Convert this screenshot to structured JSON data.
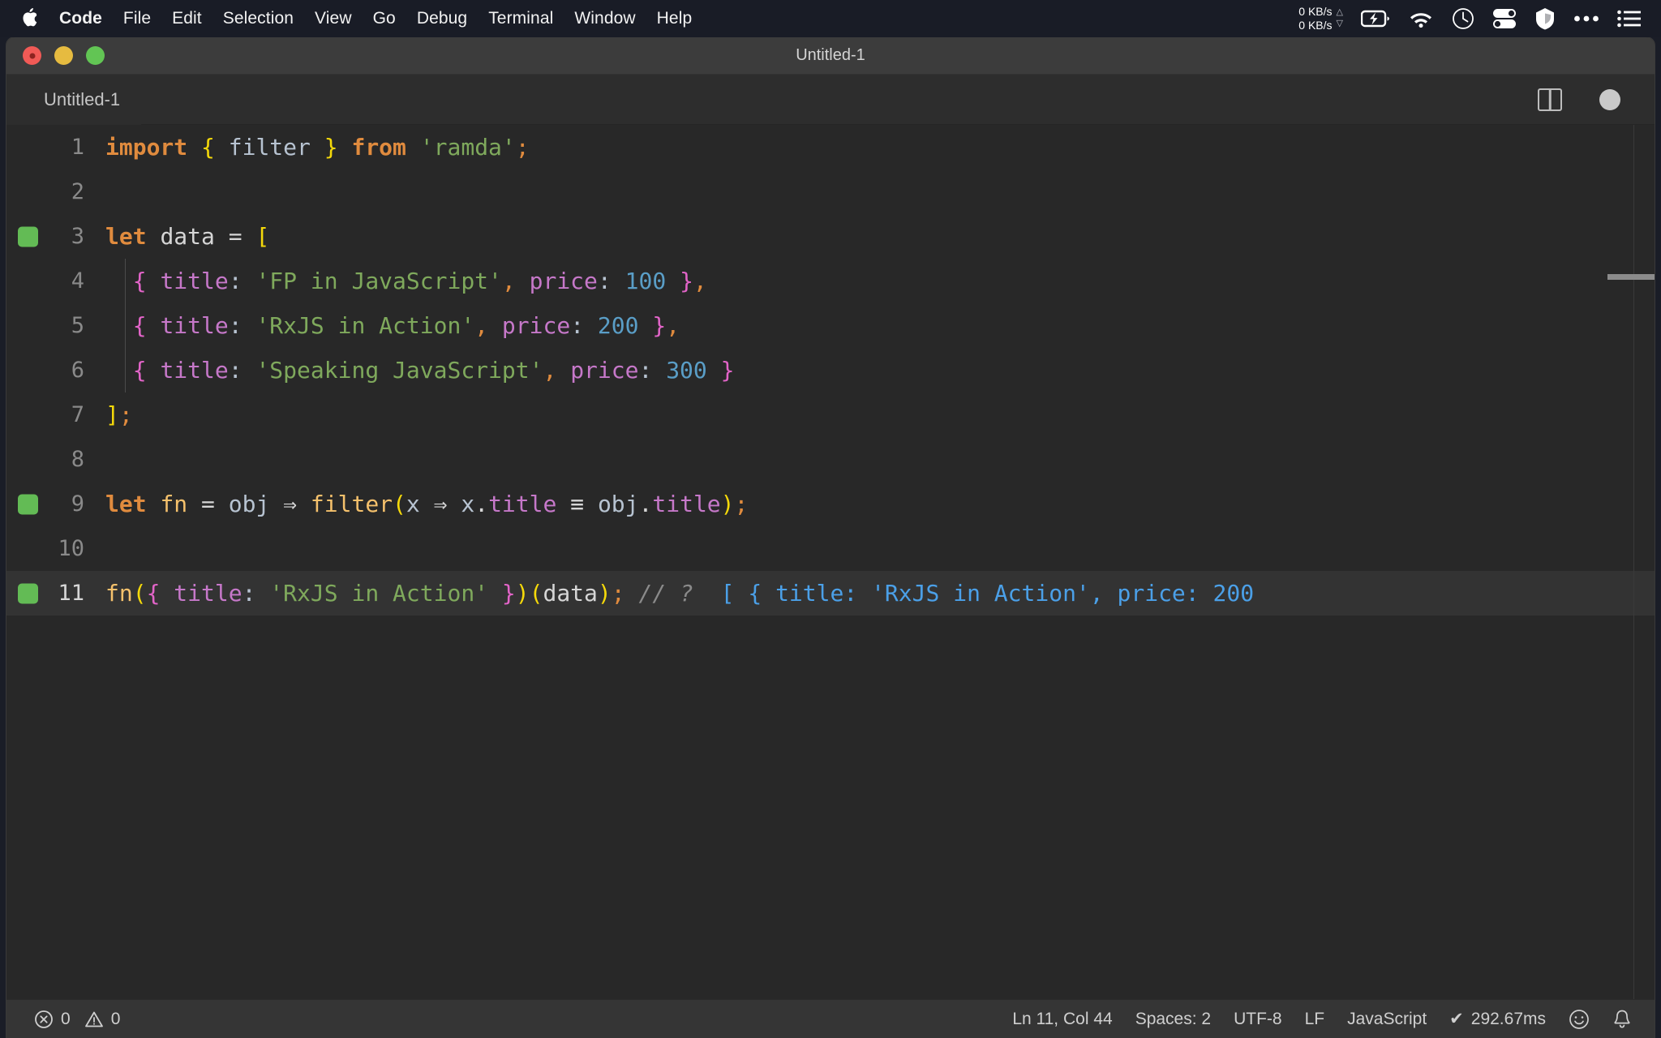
{
  "menubar": {
    "apple_icon": "apple-logo-icon",
    "items": [
      {
        "label": "Code",
        "bold": true
      },
      {
        "label": "File",
        "bold": false
      },
      {
        "label": "Edit",
        "bold": false
      },
      {
        "label": "Selection",
        "bold": false
      },
      {
        "label": "View",
        "bold": false
      },
      {
        "label": "Go",
        "bold": false
      },
      {
        "label": "Debug",
        "bold": false
      },
      {
        "label": "Terminal",
        "bold": false
      },
      {
        "label": "Window",
        "bold": false
      },
      {
        "label": "Help",
        "bold": false
      }
    ],
    "status": {
      "net_up": "0 KB/s",
      "net_down": "0 KB/s",
      "up_arrow": "△",
      "down_arrow": "▽",
      "icons": [
        "battery-charging-icon",
        "wifi-icon",
        "clock-icon",
        "toggles-icon",
        "shield-icon",
        "ellipsis-icon",
        "list-menu-icon"
      ]
    }
  },
  "window": {
    "title": "Untitled-1",
    "traffic_lights": [
      "close-button",
      "minimize-button",
      "maximize-button"
    ]
  },
  "tabbar": {
    "tab_label": "Untitled-1",
    "split_editor_icon": "split-editor-icon",
    "unsaved_indicator": "unsaved-dot-icon"
  },
  "code": {
    "lines": [
      {
        "number": "1",
        "marker": false,
        "active": false,
        "indent_guide": false,
        "tokens": [
          {
            "text": "import",
            "cls": "t-kw-b"
          },
          {
            "text": " ",
            "cls": "t-plain"
          },
          {
            "text": "{",
            "cls": "t-brace-y"
          },
          {
            "text": " ",
            "cls": "t-plain"
          },
          {
            "text": "filter",
            "cls": "t-var"
          },
          {
            "text": " ",
            "cls": "t-plain"
          },
          {
            "text": "}",
            "cls": "t-brace-y"
          },
          {
            "text": " ",
            "cls": "t-plain"
          },
          {
            "text": "from",
            "cls": "t-kw-b"
          },
          {
            "text": " ",
            "cls": "t-plain"
          },
          {
            "text": "'ramda'",
            "cls": "t-str"
          },
          {
            "text": ";",
            "cls": "t-punct-o"
          }
        ]
      },
      {
        "number": "2",
        "marker": false,
        "active": false,
        "indent_guide": false,
        "tokens": []
      },
      {
        "number": "3",
        "marker": true,
        "active": false,
        "indent_guide": false,
        "tokens": [
          {
            "text": "let",
            "cls": "t-kw-b"
          },
          {
            "text": " ",
            "cls": "t-plain"
          },
          {
            "text": "data",
            "cls": "t-plain"
          },
          {
            "text": " = ",
            "cls": "t-plain"
          },
          {
            "text": "[",
            "cls": "t-brace-y"
          }
        ]
      },
      {
        "number": "4",
        "marker": false,
        "active": false,
        "indent_guide": true,
        "tokens": [
          {
            "text": "  ",
            "cls": "t-plain"
          },
          {
            "text": "{",
            "cls": "t-brace-p"
          },
          {
            "text": " ",
            "cls": "t-plain"
          },
          {
            "text": "title",
            "cls": "t-prop"
          },
          {
            "text": ":",
            "cls": "t-colon"
          },
          {
            "text": " ",
            "cls": "t-plain"
          },
          {
            "text": "'FP in JavaScript'",
            "cls": "t-str"
          },
          {
            "text": ",",
            "cls": "t-punct-o"
          },
          {
            "text": " ",
            "cls": "t-plain"
          },
          {
            "text": "price",
            "cls": "t-prop"
          },
          {
            "text": ":",
            "cls": "t-colon"
          },
          {
            "text": " ",
            "cls": "t-plain"
          },
          {
            "text": "100",
            "cls": "t-num"
          },
          {
            "text": " ",
            "cls": "t-plain"
          },
          {
            "text": "}",
            "cls": "t-brace-p"
          },
          {
            "text": ",",
            "cls": "t-punct-o"
          }
        ]
      },
      {
        "number": "5",
        "marker": false,
        "active": false,
        "indent_guide": true,
        "tokens": [
          {
            "text": "  ",
            "cls": "t-plain"
          },
          {
            "text": "{",
            "cls": "t-brace-p"
          },
          {
            "text": " ",
            "cls": "t-plain"
          },
          {
            "text": "title",
            "cls": "t-prop"
          },
          {
            "text": ":",
            "cls": "t-colon"
          },
          {
            "text": " ",
            "cls": "t-plain"
          },
          {
            "text": "'RxJS in Action'",
            "cls": "t-str"
          },
          {
            "text": ",",
            "cls": "t-punct-o"
          },
          {
            "text": " ",
            "cls": "t-plain"
          },
          {
            "text": "price",
            "cls": "t-prop"
          },
          {
            "text": ":",
            "cls": "t-colon"
          },
          {
            "text": " ",
            "cls": "t-plain"
          },
          {
            "text": "200",
            "cls": "t-num"
          },
          {
            "text": " ",
            "cls": "t-plain"
          },
          {
            "text": "}",
            "cls": "t-brace-p"
          },
          {
            "text": ",",
            "cls": "t-punct-o"
          }
        ]
      },
      {
        "number": "6",
        "marker": false,
        "active": false,
        "indent_guide": true,
        "tokens": [
          {
            "text": "  ",
            "cls": "t-plain"
          },
          {
            "text": "{",
            "cls": "t-brace-p"
          },
          {
            "text": " ",
            "cls": "t-plain"
          },
          {
            "text": "title",
            "cls": "t-prop"
          },
          {
            "text": ":",
            "cls": "t-colon"
          },
          {
            "text": " ",
            "cls": "t-plain"
          },
          {
            "text": "'Speaking JavaScript'",
            "cls": "t-str"
          },
          {
            "text": ",",
            "cls": "t-punct-o"
          },
          {
            "text": " ",
            "cls": "t-plain"
          },
          {
            "text": "price",
            "cls": "t-prop"
          },
          {
            "text": ":",
            "cls": "t-colon"
          },
          {
            "text": " ",
            "cls": "t-plain"
          },
          {
            "text": "300",
            "cls": "t-num"
          },
          {
            "text": " ",
            "cls": "t-plain"
          },
          {
            "text": "}",
            "cls": "t-brace-p"
          }
        ]
      },
      {
        "number": "7",
        "marker": false,
        "active": false,
        "indent_guide": false,
        "tokens": [
          {
            "text": "]",
            "cls": "t-brace-y"
          },
          {
            "text": ";",
            "cls": "t-punct-o"
          }
        ]
      },
      {
        "number": "8",
        "marker": false,
        "active": false,
        "indent_guide": false,
        "tokens": []
      },
      {
        "number": "9",
        "marker": true,
        "active": false,
        "indent_guide": false,
        "tokens": [
          {
            "text": "let",
            "cls": "t-kw-b"
          },
          {
            "text": " ",
            "cls": "t-plain"
          },
          {
            "text": "fn",
            "cls": "t-fn"
          },
          {
            "text": " = ",
            "cls": "t-plain"
          },
          {
            "text": "obj",
            "cls": "t-var"
          },
          {
            "text": " ⇒ ",
            "cls": "t-plain"
          },
          {
            "text": "filter",
            "cls": "t-fn"
          },
          {
            "text": "(",
            "cls": "t-brace-y"
          },
          {
            "text": "x",
            "cls": "t-var"
          },
          {
            "text": " ⇒ ",
            "cls": "t-plain"
          },
          {
            "text": "x",
            "cls": "t-var"
          },
          {
            "text": ".",
            "cls": "t-plain"
          },
          {
            "text": "title",
            "cls": "t-prop"
          },
          {
            "text": " ≡ ",
            "cls": "t-plain"
          },
          {
            "text": "obj",
            "cls": "t-var"
          },
          {
            "text": ".",
            "cls": "t-plain"
          },
          {
            "text": "title",
            "cls": "t-prop"
          },
          {
            "text": ")",
            "cls": "t-brace-y"
          },
          {
            "text": ";",
            "cls": "t-punct-o"
          }
        ]
      },
      {
        "number": "10",
        "marker": false,
        "active": false,
        "indent_guide": false,
        "tokens": []
      },
      {
        "number": "11",
        "marker": true,
        "active": true,
        "indent_guide": false,
        "tokens": [
          {
            "text": "fn",
            "cls": "t-fn"
          },
          {
            "text": "(",
            "cls": "t-brace-y"
          },
          {
            "text": "{",
            "cls": "t-brace-p"
          },
          {
            "text": " ",
            "cls": "t-plain"
          },
          {
            "text": "title",
            "cls": "t-prop"
          },
          {
            "text": ":",
            "cls": "t-colon"
          },
          {
            "text": " ",
            "cls": "t-plain"
          },
          {
            "text": "'RxJS in Action'",
            "cls": "t-str"
          },
          {
            "text": " ",
            "cls": "t-plain"
          },
          {
            "text": "}",
            "cls": "t-brace-p"
          },
          {
            "text": ")",
            "cls": "t-brace-y"
          },
          {
            "text": "(",
            "cls": "t-brace-y"
          },
          {
            "text": "data",
            "cls": "t-plain"
          },
          {
            "text": ")",
            "cls": "t-brace-y"
          },
          {
            "text": ";",
            "cls": "t-punct-o"
          },
          {
            "text": " ",
            "cls": "t-plain"
          },
          {
            "text": "// ?",
            "cls": "t-comment"
          },
          {
            "text": "  ",
            "cls": "t-plain"
          },
          {
            "text": "[ { title: 'RxJS in Action', price: 200",
            "cls": "t-result"
          }
        ]
      }
    ]
  },
  "statusbar": {
    "errors_icon": "error-circle-icon",
    "errors": "0",
    "warnings_icon": "warning-triangle-icon",
    "warnings": "0",
    "cursor_position": "Ln 11, Col 44",
    "indentation": "Spaces: 2",
    "encoding": "UTF-8",
    "eol": "LF",
    "language": "JavaScript",
    "quokka_check": "✔",
    "quokka_time": "292.67ms",
    "feedback_icon": "smiley-icon",
    "notifications_icon": "bell-icon"
  }
}
